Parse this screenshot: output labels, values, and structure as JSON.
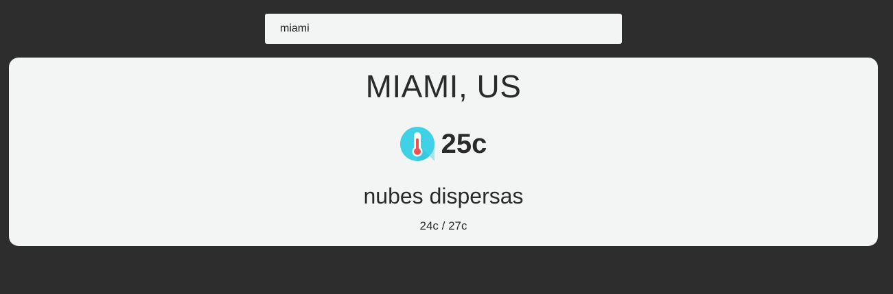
{
  "search": {
    "value": "miami",
    "placeholder": ""
  },
  "weather": {
    "city": "MIAMI, US",
    "temperature": "25c",
    "description": "nubes dispersas",
    "min_max": "24c / 27c",
    "icon": "thermometer-icon"
  },
  "colors": {
    "background": "#2d2d2d",
    "card": "#f3f5f4",
    "icon_circle": "#3fd2e6",
    "mercury": "#f0504f"
  }
}
